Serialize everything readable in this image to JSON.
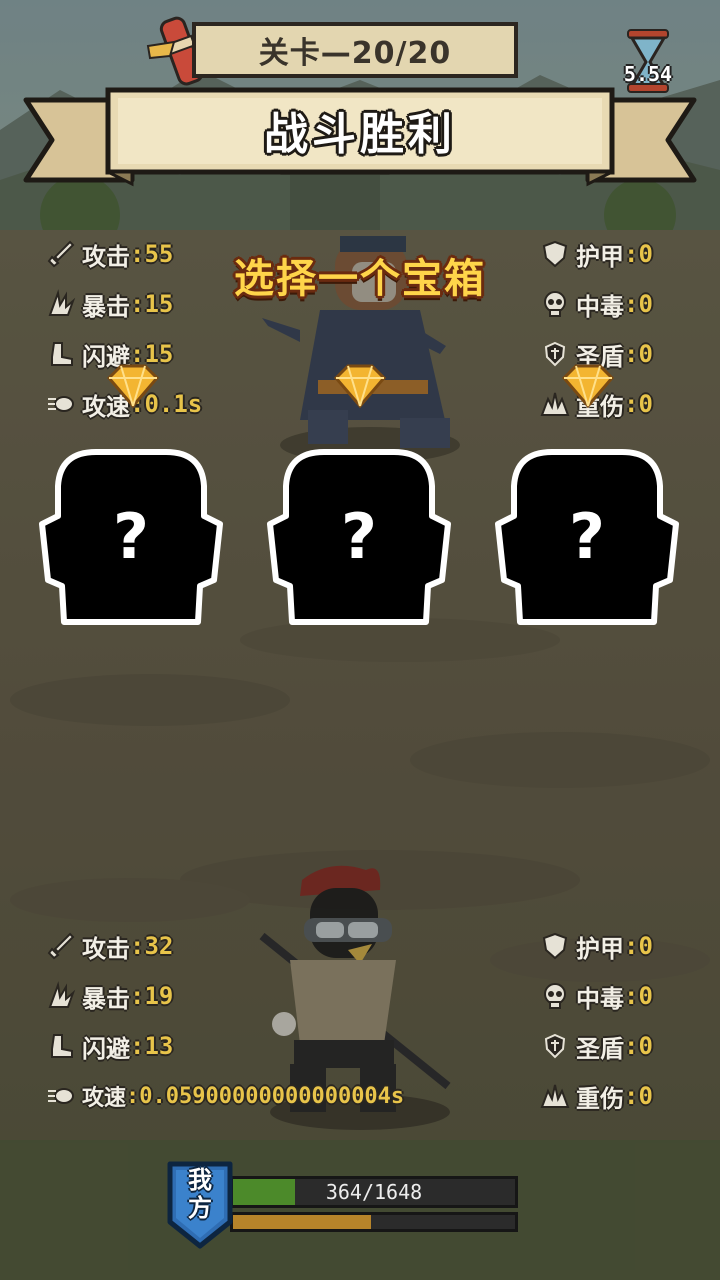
{
  "stage": {
    "label": "关卡—20/20"
  },
  "timer": {
    "value": "5.54"
  },
  "banner": {
    "title": "战斗胜利"
  },
  "prompt": {
    "text": "选择一个宝箱"
  },
  "enemy_stats": {
    "left": [
      {
        "icon": "sword-icon",
        "label": "攻击",
        "value": "55"
      },
      {
        "icon": "crit-claw-icon",
        "label": "暴击",
        "value": "15"
      },
      {
        "icon": "boot-icon",
        "label": "闪避",
        "value": "15"
      },
      {
        "icon": "speed-icon",
        "label": "攻速",
        "value": "0.1s"
      }
    ],
    "right": [
      {
        "icon": "shield-icon",
        "label": "护甲",
        "value": "0"
      },
      {
        "icon": "skull-icon",
        "label": "中毒",
        "value": "0"
      },
      {
        "icon": "holy-shield-icon",
        "label": "圣盾",
        "value": "0"
      },
      {
        "icon": "heavy-wound-icon",
        "label": "重伤",
        "value": "0"
      }
    ]
  },
  "player_stats": {
    "left": [
      {
        "icon": "sword-icon",
        "label": "攻击",
        "value": "32"
      },
      {
        "icon": "crit-claw-icon",
        "label": "暴击",
        "value": "19"
      },
      {
        "icon": "boot-icon",
        "label": "闪避",
        "value": "13"
      },
      {
        "icon": "speed-icon",
        "label": "攻速",
        "value": "0.05900000000000004s"
      }
    ],
    "right": [
      {
        "icon": "shield-icon",
        "label": "护甲",
        "value": "0"
      },
      {
        "icon": "skull-icon",
        "label": "中毒",
        "value": "0"
      },
      {
        "icon": "holy-shield-icon",
        "label": "圣盾",
        "value": "0"
      },
      {
        "icon": "heavy-wound-icon",
        "label": "重伤",
        "value": "0"
      }
    ]
  },
  "chests": [
    {
      "mark": "?",
      "icon": "mystery-chest-icon"
    },
    {
      "mark": "?",
      "icon": "mystery-chest-icon"
    },
    {
      "mark": "?",
      "icon": "mystery-chest-icon"
    }
  ],
  "player_bar": {
    "side_label": "我方",
    "hp_text": "364/1648",
    "hp_fraction": 0.221,
    "xp_fraction": 0.49
  },
  "colors": {
    "stat_value": "#e8c44a",
    "prompt": "#ffd54a",
    "hp_fill": "#4c8a2a",
    "xp_fill": "#b7842a",
    "badge": "#2f6db3"
  }
}
